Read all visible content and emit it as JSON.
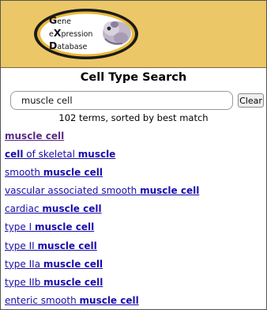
{
  "logo": {
    "line1": {
      "big": "G",
      "rest": "ene"
    },
    "line2": {
      "pre": "e",
      "big": "X",
      "rest": "pression"
    },
    "line3": {
      "big": "D",
      "rest": "atabase"
    }
  },
  "page_title": "Cell Type Search",
  "search": {
    "value": "muscle cell",
    "clear_label": "Clear"
  },
  "summary": "102 terms, sorted by best match",
  "results": [
    {
      "parts": [
        {
          "t": "muscle cell",
          "b": true
        }
      ],
      "visited": true
    },
    {
      "parts": [
        {
          "t": "cell",
          "b": true
        },
        {
          "t": " of skeletal ",
          "b": false
        },
        {
          "t": "muscle",
          "b": true
        }
      ]
    },
    {
      "parts": [
        {
          "t": "smooth ",
          "b": false
        },
        {
          "t": "muscle cell",
          "b": true
        }
      ]
    },
    {
      "parts": [
        {
          "t": "vascular associated smooth ",
          "b": false
        },
        {
          "t": "muscle cell",
          "b": true
        }
      ]
    },
    {
      "parts": [
        {
          "t": "cardiac ",
          "b": false
        },
        {
          "t": "muscle cell",
          "b": true
        }
      ]
    },
    {
      "parts": [
        {
          "t": "type I ",
          "b": false
        },
        {
          "t": "muscle cell",
          "b": true
        }
      ]
    },
    {
      "parts": [
        {
          "t": "type II ",
          "b": false
        },
        {
          "t": "muscle cell",
          "b": true
        }
      ]
    },
    {
      "parts": [
        {
          "t": "type IIa ",
          "b": false
        },
        {
          "t": "muscle cell",
          "b": true
        }
      ]
    },
    {
      "parts": [
        {
          "t": "type IIb ",
          "b": false
        },
        {
          "t": "muscle cell",
          "b": true
        }
      ]
    },
    {
      "parts": [
        {
          "t": "enteric smooth ",
          "b": false
        },
        {
          "t": "muscle cell",
          "b": true
        }
      ]
    }
  ],
  "colors": {
    "header_bg": "#ecc767",
    "link": "#1a0dab",
    "visited_link": "#5a2a86"
  },
  "icons": [
    "gxd-logo-icon",
    "mouse-embryo-icon"
  ]
}
